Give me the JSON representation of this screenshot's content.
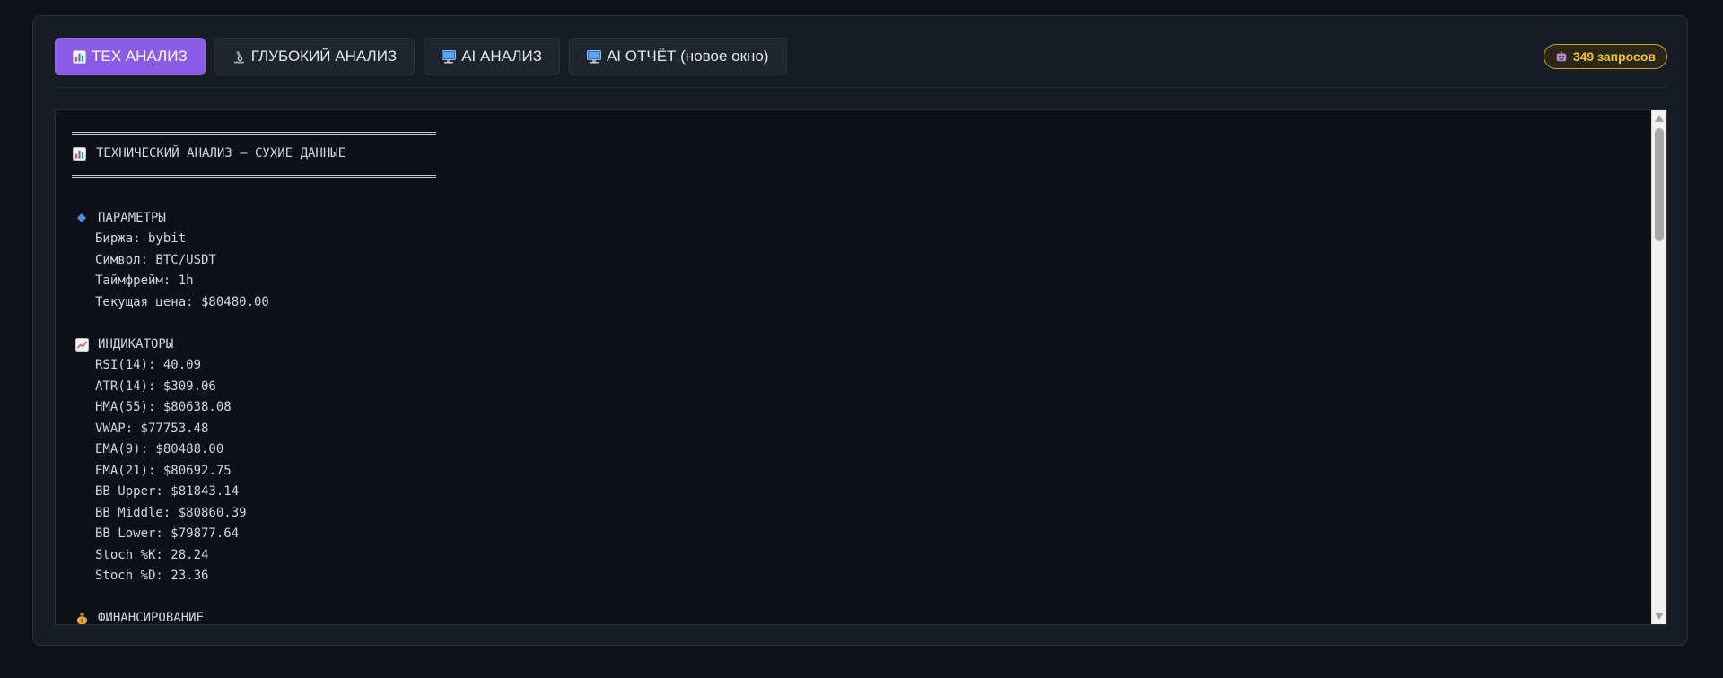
{
  "tabs": [
    {
      "label": "ТЕХ АНАЛИЗ",
      "icon": "bar-chart-icon",
      "active": true
    },
    {
      "label": "ГЛУБОКИЙ АНАЛИЗ",
      "icon": "microscope-icon",
      "active": false
    },
    {
      "label": "AI АНАЛИЗ",
      "icon": "computer-icon",
      "active": false
    },
    {
      "label": "AI ОТЧЁТ (новое окно)",
      "icon": "computer-icon",
      "active": false
    }
  ],
  "badge": {
    "icon": "robot-icon",
    "text": "349 запросов"
  },
  "report": {
    "title": "ТЕХНИЧЕСКИЙ АНАЛИЗ — СУХИЕ ДАННЫЕ",
    "params": {
      "heading": "ПАРАМЕТРЫ",
      "lines": [
        "Биржа: bybit",
        "Символ: BTC/USDT",
        "Таймфрейм: 1h",
        "Текущая цена: $80480.00"
      ]
    },
    "indicators": {
      "heading": "ИНДИКАТОРЫ",
      "lines": [
        "RSI(14): 40.09",
        "ATR(14): $309.06",
        "HMA(55): $80638.08",
        "VWAP: $77753.48",
        "EMA(9): $80488.00",
        "EMA(21): $80692.75",
        "BB Upper: $81843.14",
        "BB Middle: $80860.39",
        "BB Lower: $79877.64",
        "Stoch %K: 28.24",
        "Stoch %D: 23.36"
      ]
    },
    "funding": {
      "heading": "ФИНАНСИРОВАНИЕ"
    }
  },
  "colors": {
    "accent": "#8a5ce6",
    "badge": "#f2c23a",
    "background": "#0e1218"
  }
}
